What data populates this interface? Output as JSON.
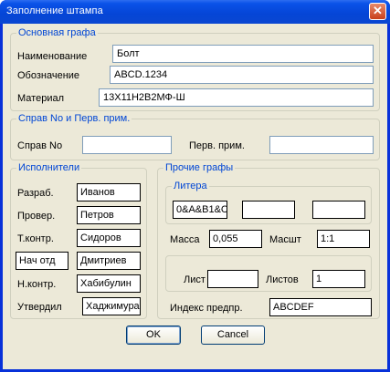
{
  "window": {
    "title": "Заполнение штампа",
    "close_glyph": "✕"
  },
  "main_group": {
    "title": "Основная графа",
    "name_label": "Наименование",
    "name_value": "Болт",
    "designation_label": "Обозначение",
    "designation_value": "ABCD.1234",
    "material_label": "Материал",
    "material_value": "13Х11Н2В2МФ-Ш"
  },
  "ref_group": {
    "title": "Справ No и Перв. прим.",
    "ref_label": "Справ No",
    "ref_value": "",
    "first_label": "Перв. прим.",
    "first_value": ""
  },
  "performers": {
    "title": "Исполнители",
    "rows": [
      {
        "label": "Разраб.",
        "value": "Иванов"
      },
      {
        "label": "Провер.",
        "value": "Петров"
      },
      {
        "label": "Т.контр.",
        "value": "Сидоров"
      },
      {
        "label": "Нач отд",
        "value": "Дмитриев"
      },
      {
        "label": "Н.контр.",
        "value": "Хабибулин"
      },
      {
        "label": "Утвердил",
        "value": "Хаджимура"
      }
    ]
  },
  "other": {
    "title": "Прочие графы",
    "litera_title": "Литера",
    "litera_values": [
      "0&A&B1&C",
      "",
      ""
    ],
    "mass_label": "Масса",
    "mass_value": "0,055",
    "scale_label": "Масшт",
    "scale_value": "1:1",
    "sheet_label": "Лист",
    "sheet_value": "",
    "sheets_label": "Листов",
    "sheets_value": "1",
    "index_label": "Индекс предпр.",
    "index_value": "ABCDEF"
  },
  "buttons": {
    "ok": "OK",
    "cancel": "Cancel"
  }
}
